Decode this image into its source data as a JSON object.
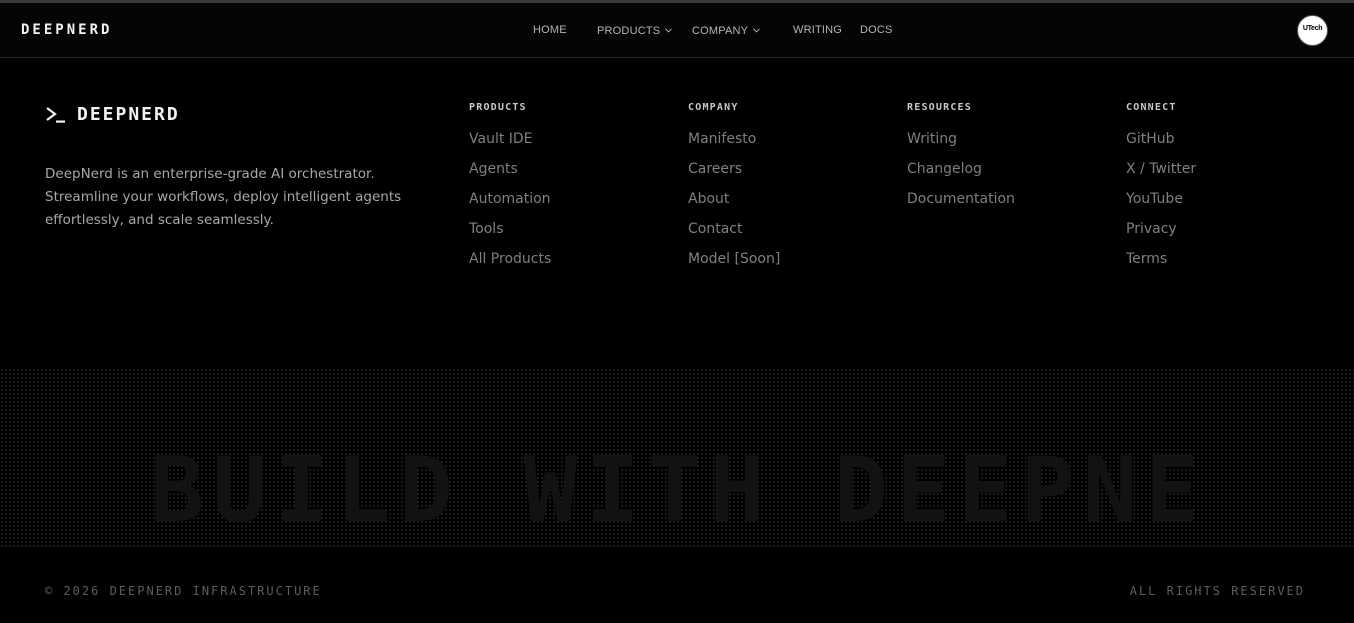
{
  "header": {
    "brand": "DEEPNERD",
    "nav": [
      {
        "label": "HOME"
      },
      {
        "label": "PRODUCTS"
      },
      {
        "label": "COMPANY"
      },
      {
        "label": "WRITING"
      },
      {
        "label": "DOCS"
      }
    ],
    "avatar_text": "UTech"
  },
  "footer": {
    "logo_text": "DEEPNERD",
    "description": "DeepNerd is an enterprise-grade AI orchestrator. Streamline your workflows, deploy intelligent agents effortlessly, and scale seamlessly.",
    "columns": [
      {
        "title": "PRODUCTS",
        "links": [
          "Vault IDE",
          "Agents",
          "Automation",
          "Tools",
          "All Products"
        ]
      },
      {
        "title": "COMPANY",
        "links": [
          "Manifesto",
          "Careers",
          "About",
          "Contact",
          "Model [Soon]"
        ]
      },
      {
        "title": "RESOURCES",
        "links": [
          "Writing",
          "Changelog",
          "Documentation"
        ]
      },
      {
        "title": "CONNECT",
        "links": [
          "GitHub",
          "X / Twitter",
          "YouTube",
          "Privacy",
          "Terms"
        ]
      }
    ],
    "big_word": "BUILD WITH DEEPNERD",
    "copyright": "© 2026 DEEPNERD INFRASTRUCTURE",
    "rights": "ALL RIGHTS RESERVED"
  },
  "icons": {
    "chevron": "chevron-down-icon",
    "prompt": "terminal-prompt-icon"
  }
}
